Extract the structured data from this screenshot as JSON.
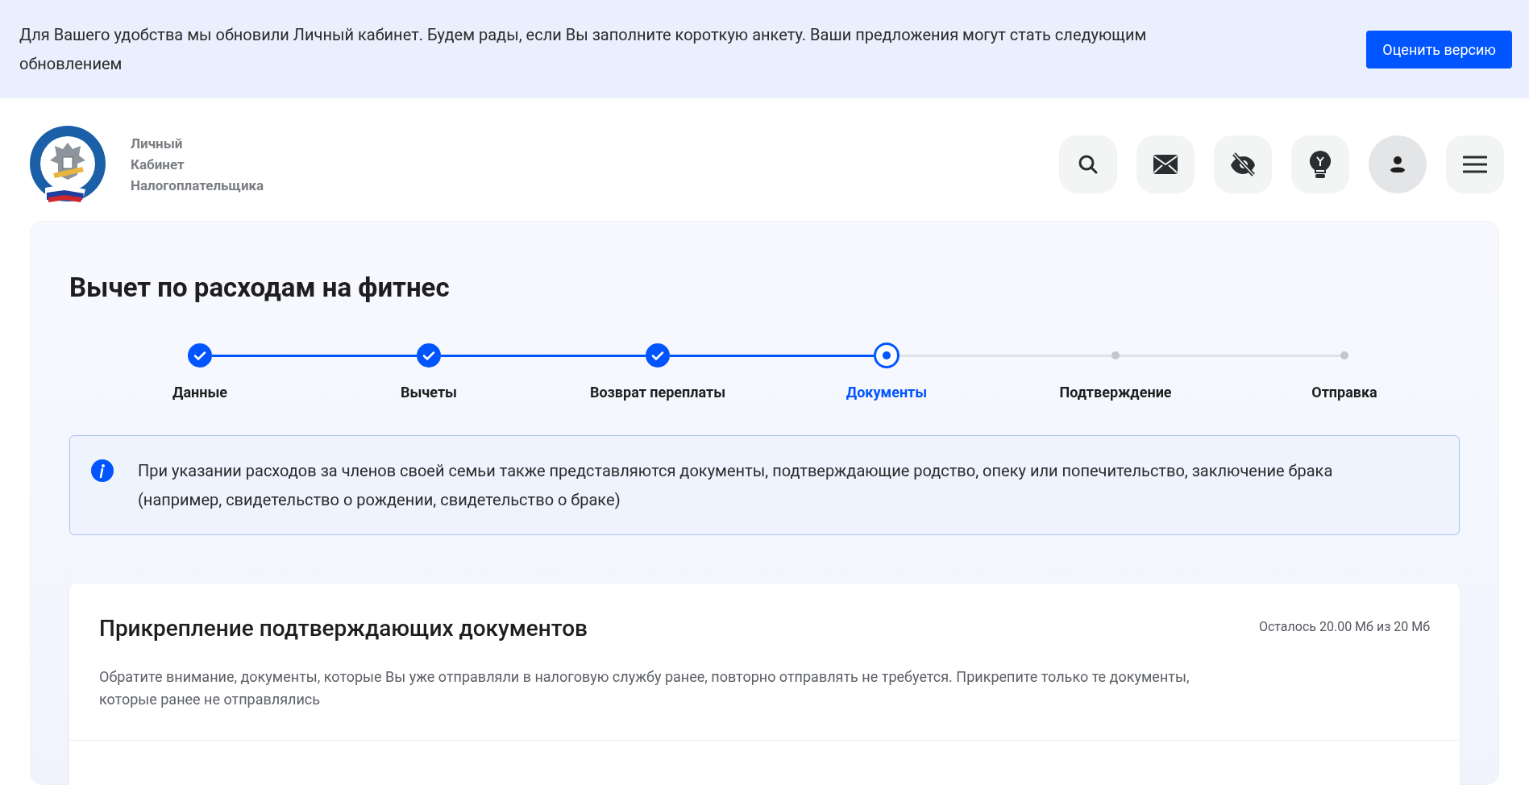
{
  "banner": {
    "text": "Для Вашего удобства мы обновили Личный кабинет. Будем рады, если Вы заполните короткую анкету. Ваши предложения могут стать следующим обновлением",
    "button": "Оценить версию"
  },
  "header": {
    "logo_text": [
      "Личный",
      "Кабинет",
      "Налогоплательщика"
    ]
  },
  "page": {
    "title": "Вычет по расходам на фитнес",
    "steps": [
      {
        "label": "Данные",
        "done": true,
        "selected": false
      },
      {
        "label": "Вычеты",
        "done": true,
        "selected": false
      },
      {
        "label": "Возврат переплаты",
        "done": true,
        "selected": false
      },
      {
        "label": "Документы",
        "done": false,
        "selected": true
      },
      {
        "label": "Подтверждение",
        "done": false,
        "selected": false
      },
      {
        "label": "Отправка",
        "done": false,
        "selected": false
      }
    ],
    "info": "При указании расходов за членов своей семьи также представляются документы, подтверждающие родство, опеку или попечительство, заключение брака (например, свидетельство о рождении, свидетельство о браке)",
    "attach": {
      "title": "Прикрепление подтверждающих документов",
      "quota": "Осталось 20.00 Мб из 20 Мб",
      "note": "Обратите внимание, документы, которые Вы уже отправляли в налоговую службу ранее, повторно отправлять не требуется. Прикрепите только те документы, которые ранее не отправлялись"
    }
  }
}
